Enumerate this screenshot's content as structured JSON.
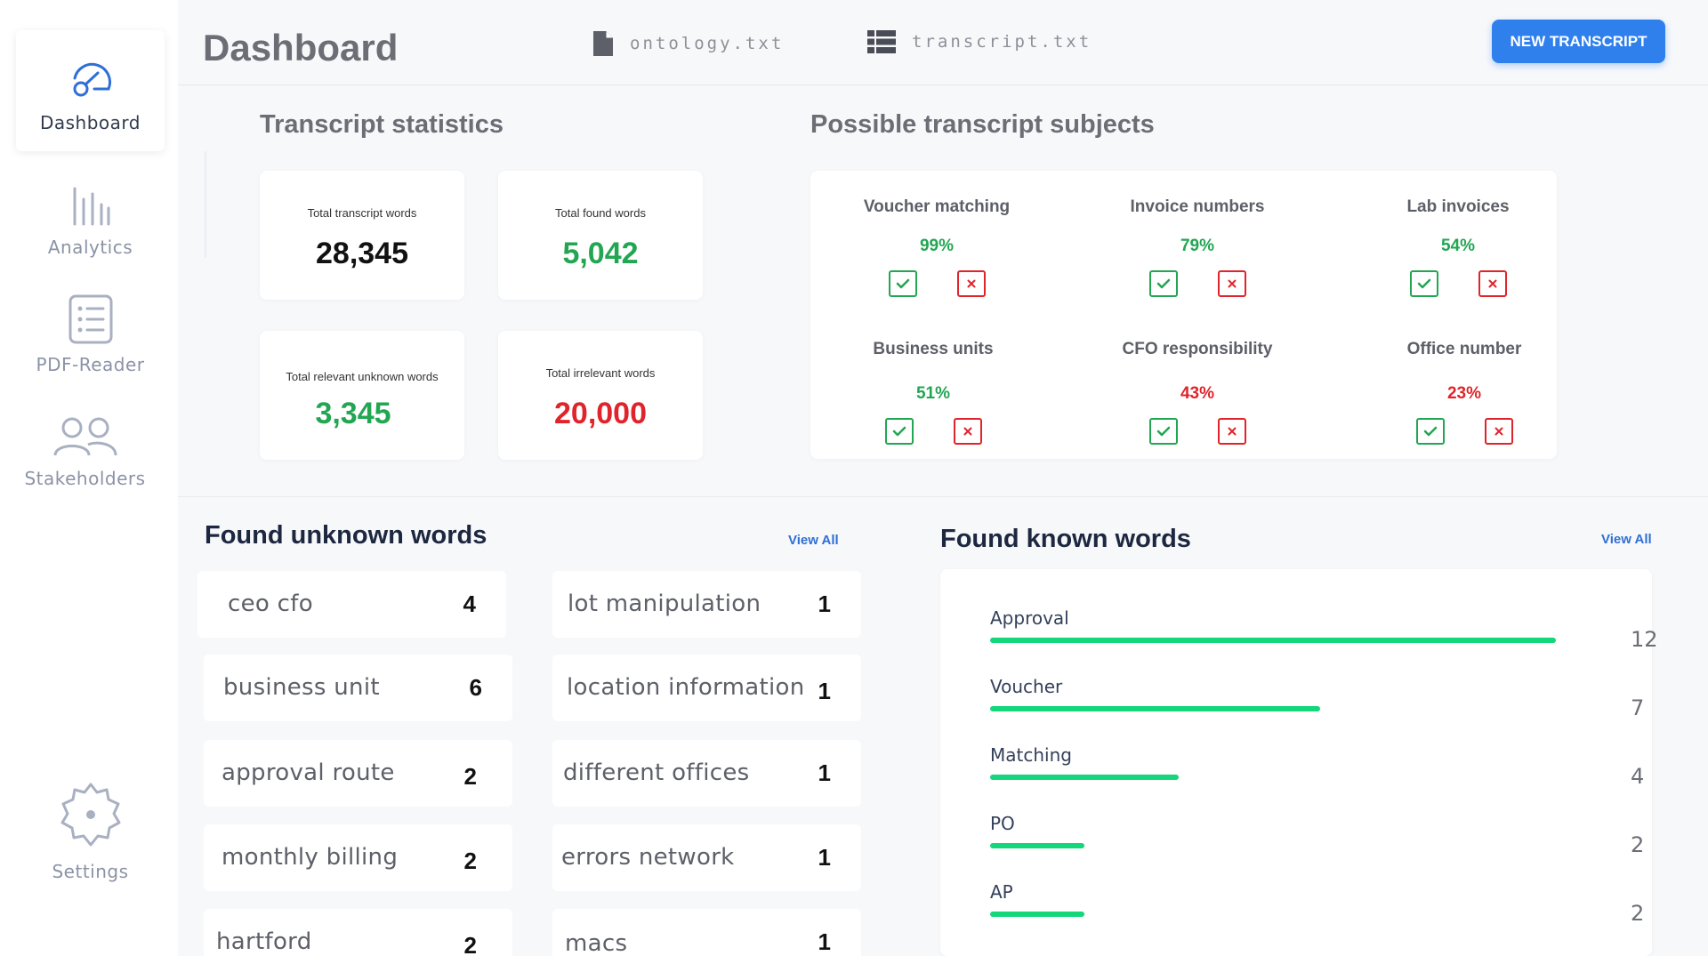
{
  "colors": {
    "accent": "#2f80ed",
    "green": "#22a652",
    "red": "#e0242b",
    "bar": "#14d67a"
  },
  "sidebar": {
    "items": [
      {
        "label": "Dashboard",
        "icon": "dashboard-gauge-icon"
      },
      {
        "label": "Analytics",
        "icon": "analytics-bars-icon"
      },
      {
        "label": "PDF-Reader",
        "icon": "document-list-icon"
      },
      {
        "label": "Stakeholders",
        "icon": "users-icon"
      },
      {
        "label": "Settings",
        "icon": "gear-icon"
      }
    ]
  },
  "header": {
    "title": "Dashboard",
    "files": [
      {
        "name": "ontology.txt",
        "icon": "file-icon"
      },
      {
        "name": "transcript.txt",
        "icon": "list-grid-icon"
      }
    ],
    "new_button": "NEW TRANSCRIPT"
  },
  "stats": {
    "title": "Transcript statistics",
    "cards": [
      {
        "label": "Total transcript words",
        "value": "28,345",
        "color": "#111111"
      },
      {
        "label": "Total found words",
        "value": "5,042",
        "color": "#22a652"
      },
      {
        "label": "Total relevant unknown words",
        "value": "3,345",
        "color": "#22a652"
      },
      {
        "label": "Total irrelevant words",
        "value": "20,000",
        "color": "#e0242b"
      }
    ]
  },
  "subjects": {
    "title": "Possible transcript subjects",
    "items": [
      {
        "name": "Voucher matching",
        "pct": "99%",
        "color": "#22a652"
      },
      {
        "name": "Invoice numbers",
        "pct": "79%",
        "color": "#22a652"
      },
      {
        "name": "Lab invoices",
        "pct": "54%",
        "color": "#22a652"
      },
      {
        "name": "Business units",
        "pct": "51%",
        "color": "#22a652"
      },
      {
        "name": "CFO responsibility",
        "pct": "43%",
        "color": "#e0242b"
      },
      {
        "name": "Office number",
        "pct": "23%",
        "color": "#e0242b"
      }
    ]
  },
  "unknown_words": {
    "title": "Found unknown words",
    "view_all": "View All",
    "items": [
      {
        "word": "ceo cfo",
        "count": "4"
      },
      {
        "word": "lot manipulation",
        "count": "1"
      },
      {
        "word": "business unit",
        "count": "6"
      },
      {
        "word": "location information",
        "count": "1"
      },
      {
        "word": "approval route",
        "count": "2"
      },
      {
        "word": "different offices",
        "count": "1"
      },
      {
        "word": "monthly billing",
        "count": "2"
      },
      {
        "word": "errors network",
        "count": "1"
      },
      {
        "word": "hartford",
        "count": "2"
      },
      {
        "word": "macs",
        "count": "1"
      }
    ]
  },
  "known_words": {
    "title": "Found known words",
    "view_all": "View All",
    "max": 12,
    "items": [
      {
        "word": "Approval",
        "count": 12
      },
      {
        "word": "Voucher",
        "count": 7
      },
      {
        "word": "Matching",
        "count": 4
      },
      {
        "word": "PO",
        "count": 2
      },
      {
        "word": "AP",
        "count": 2
      }
    ]
  }
}
